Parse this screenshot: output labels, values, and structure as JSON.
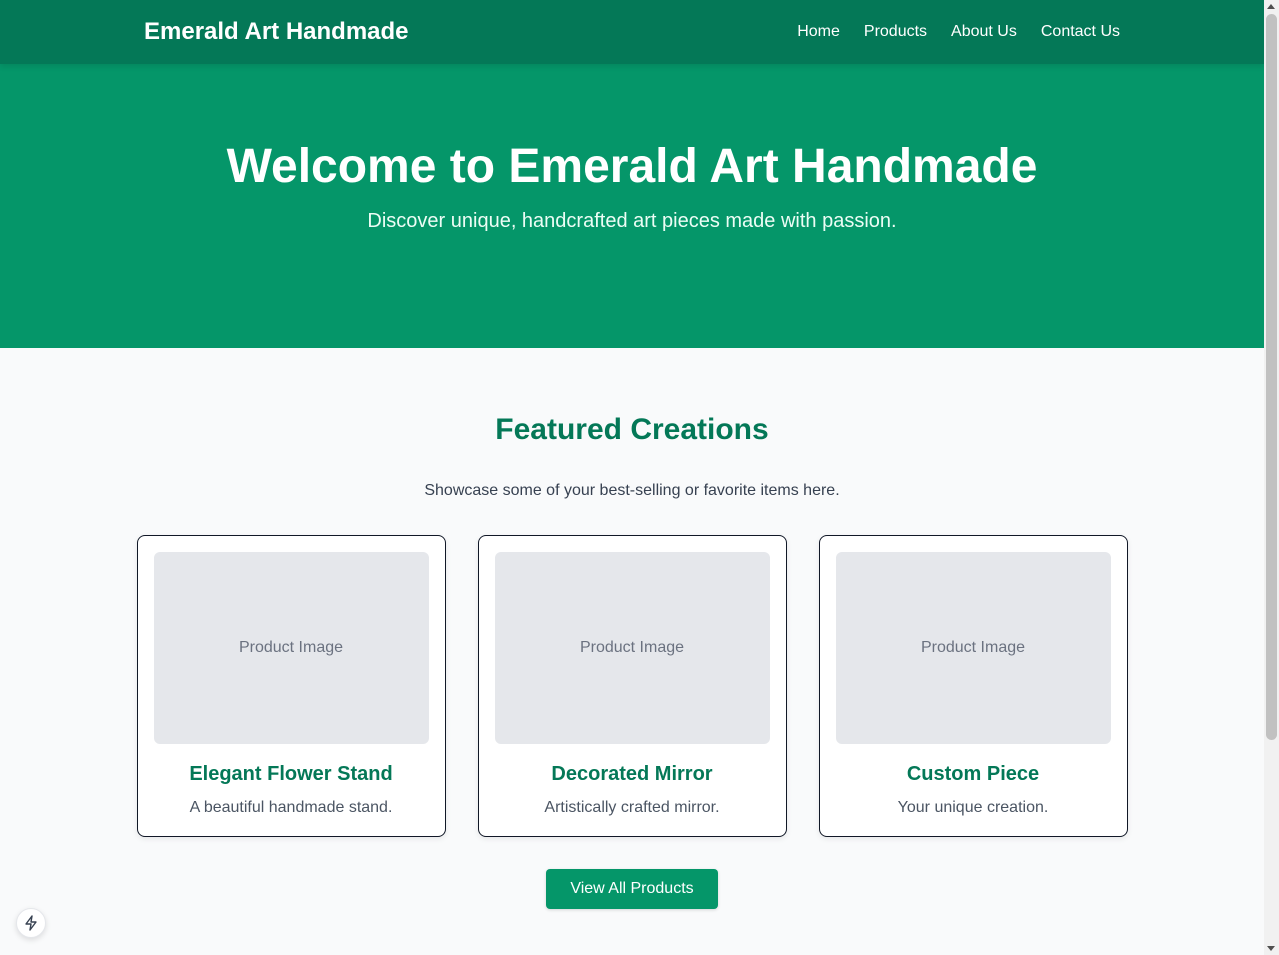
{
  "header": {
    "brand": "Emerald Art Handmade",
    "nav": [
      "Home",
      "Products",
      "About Us",
      "Contact Us"
    ]
  },
  "hero": {
    "title": "Welcome to Emerald Art Handmade",
    "subtitle": "Discover unique, handcrafted art pieces made with passion."
  },
  "featured": {
    "heading": "Featured Creations",
    "subheading": "Showcase some of your best-selling or favorite items here.",
    "products": [
      {
        "image_label": "Product Image",
        "title": "Elegant Flower Stand",
        "description": "A beautiful handmade stand."
      },
      {
        "image_label": "Product Image",
        "title": "Decorated Mirror",
        "description": "Artistically crafted mirror."
      },
      {
        "image_label": "Product Image",
        "title": "Custom Piece",
        "description": "Your unique creation."
      }
    ],
    "cta_label": "View All Products"
  },
  "colors": {
    "header_bg": "#047857",
    "hero_bg": "#059669",
    "accent_text": "#047857",
    "page_bg": "#f9fafb"
  },
  "icons": {
    "dev_badge": "lightning-bolt-icon"
  }
}
